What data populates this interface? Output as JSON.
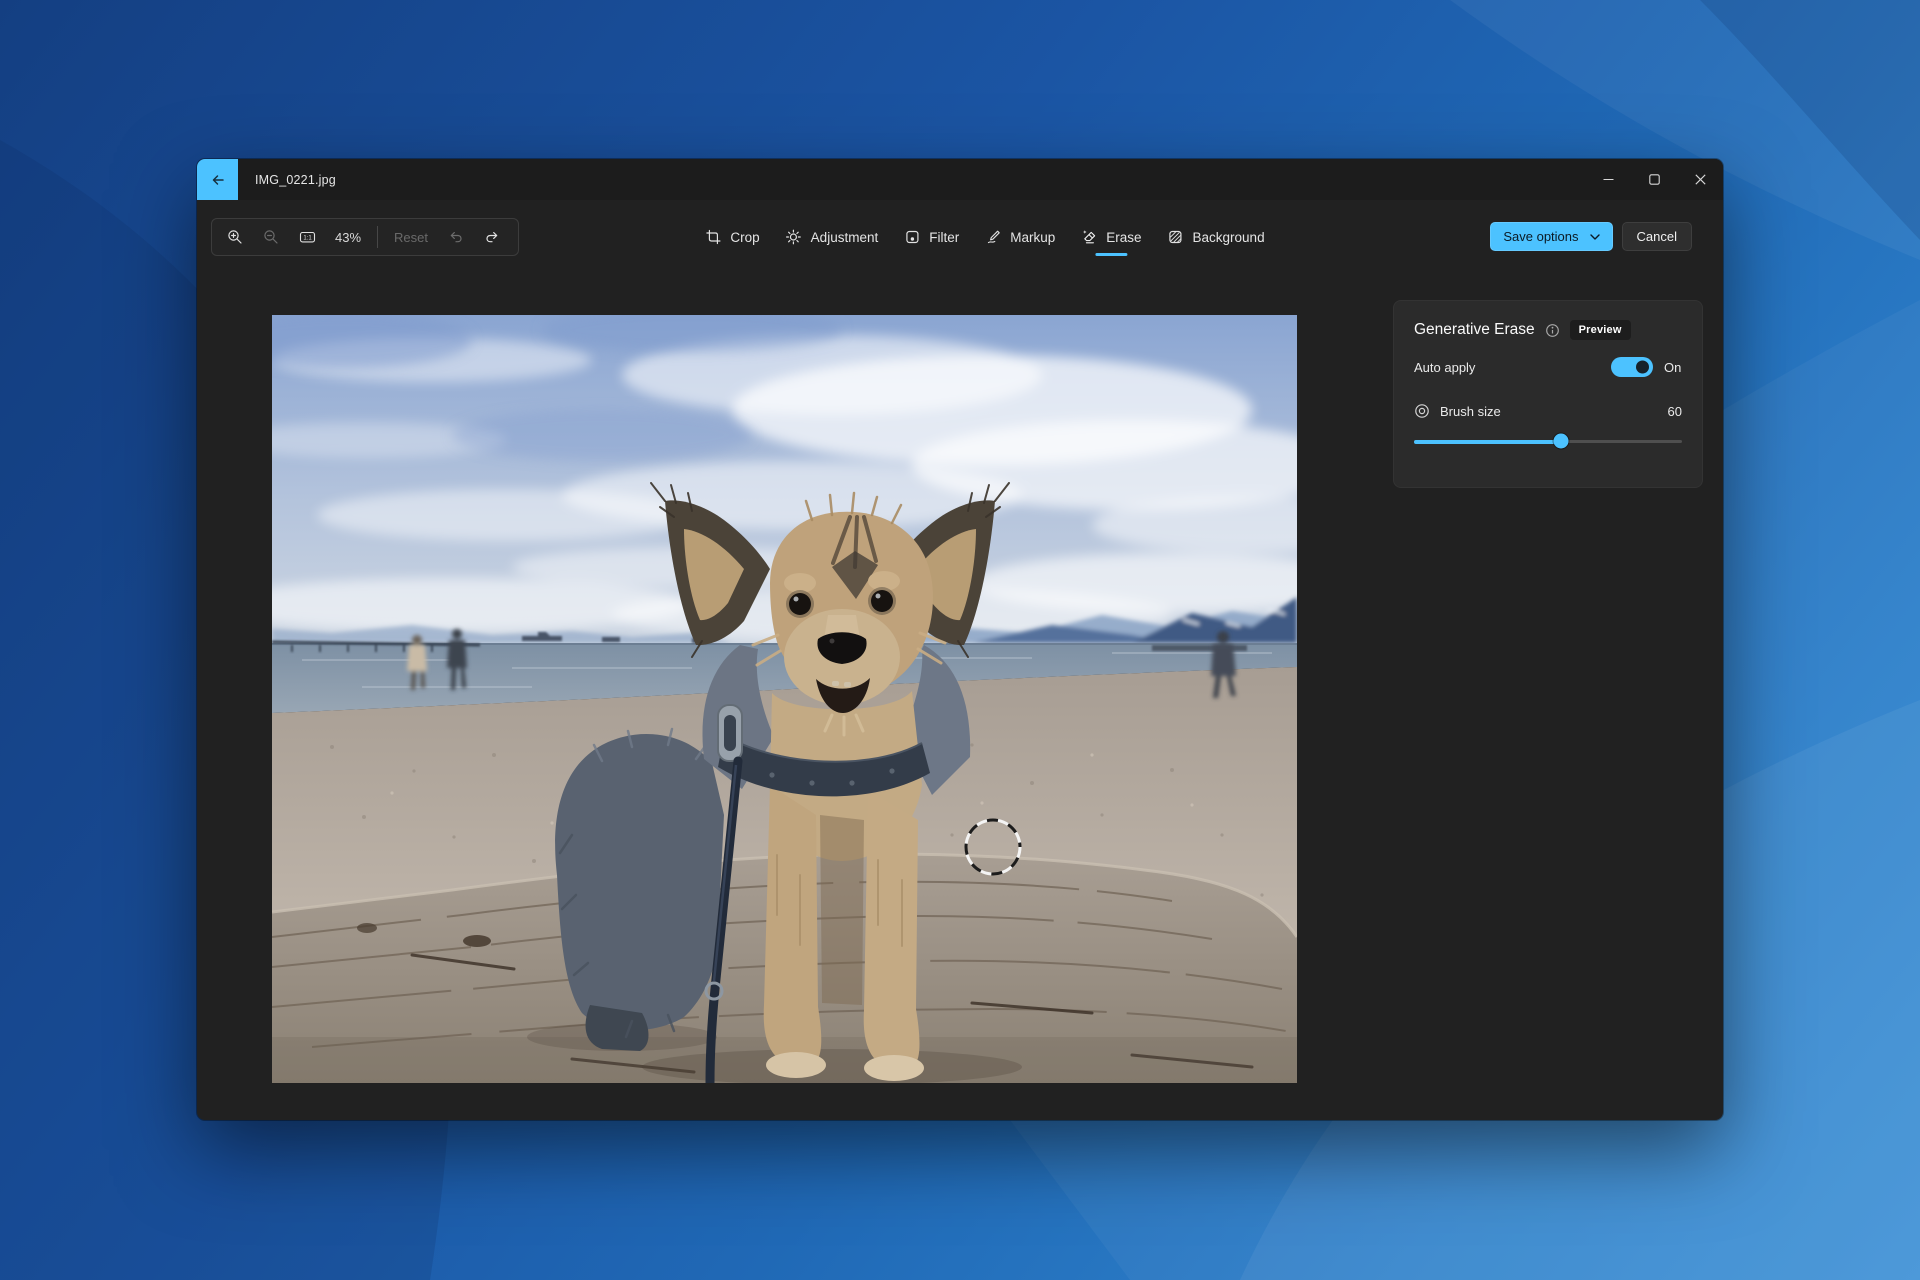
{
  "accent_color": "#4CC2FF",
  "window": {
    "titlebar": {
      "title": "IMG_0221.jpg"
    },
    "toolbar": {
      "zoom_level": "43%",
      "reset_label": "Reset"
    },
    "tabs": [
      {
        "label": "Crop",
        "active": false
      },
      {
        "label": "Adjustment",
        "active": false
      },
      {
        "label": "Filter",
        "active": false
      },
      {
        "label": "Markup",
        "active": false
      },
      {
        "label": "Erase",
        "active": true
      },
      {
        "label": "Background",
        "active": false
      }
    ],
    "actions": {
      "save_label": "Save options",
      "cancel_label": "Cancel"
    },
    "panel": {
      "title": "Generative Erase",
      "badge": "Preview",
      "auto_apply_label": "Auto apply",
      "auto_apply_state": "On",
      "brush_size_label": "Brush size",
      "brush_size_value": "60",
      "slider_percent": 55
    }
  },
  "photo": {
    "description": "Yorkshire terrier on a leash standing on driftwood at a beach; sea, mountains and cloudy sky behind; two people at the waterline left, one person right; dashed brush cursor circle on the sand",
    "key_colors": {
      "sky": "#9DB4DA",
      "sea": "#8493A7",
      "sand": "#B3AAA0",
      "wood": "#9C9287",
      "dog_tan": "#C2A47E",
      "dog_dark": "#596270"
    }
  }
}
